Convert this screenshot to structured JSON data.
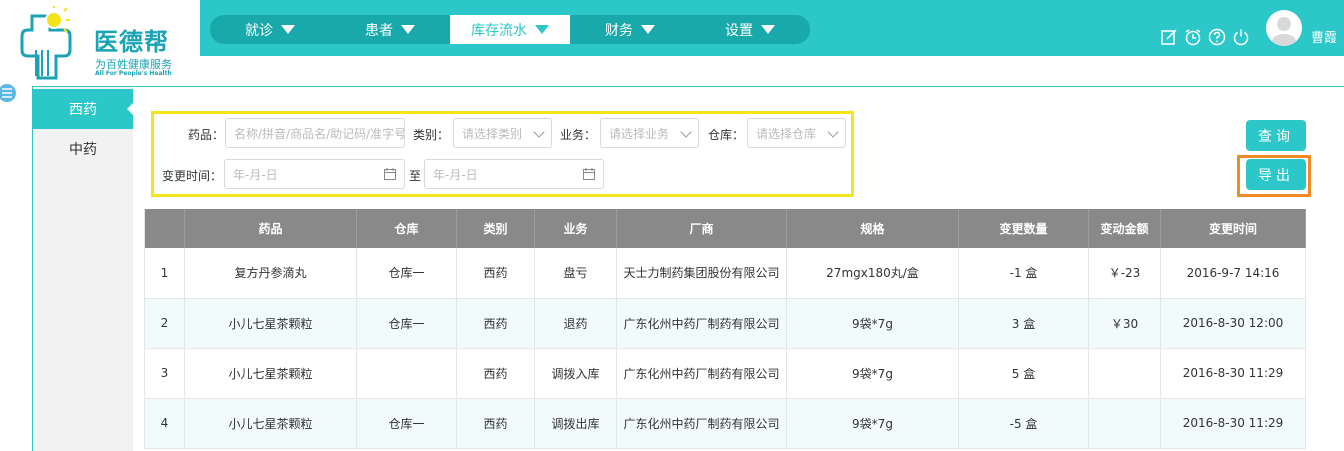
{
  "brand": {
    "name": "医德帮",
    "slogan": "为百姓健康服务",
    "slogan_en": "All For People's Health"
  },
  "nav": {
    "items": [
      {
        "label": "就诊",
        "active": false
      },
      {
        "label": "患者",
        "active": false
      },
      {
        "label": "库存流水",
        "active": true
      },
      {
        "label": "财务",
        "active": false
      },
      {
        "label": "设置",
        "active": false
      }
    ]
  },
  "header": {
    "icons": [
      "edit-icon",
      "clock-icon",
      "help-icon",
      "power-icon"
    ],
    "user_name": "曹霞"
  },
  "side_tabs": [
    {
      "label": "西药",
      "active": true
    },
    {
      "label": "中药",
      "active": false
    }
  ],
  "filter": {
    "drug_label": "药品：",
    "drug_placeholder": "名称/拼音/商品名/助记码/准字号",
    "category_label": "类别：",
    "category_placeholder": "请选择类别",
    "business_label": "业务：",
    "business_placeholder": "请选择业务",
    "warehouse_label": "仓库：",
    "warehouse_placeholder": "请选择仓库",
    "time_label": "变更时间：",
    "date_start_placeholder": "年-月-日",
    "to_label": "至",
    "date_end_placeholder": "年-月-日"
  },
  "buttons": {
    "query": "查询",
    "export": "导出"
  },
  "table": {
    "headers": [
      "",
      "药品",
      "仓库",
      "类别",
      "业务",
      "厂商",
      "规格",
      "变更数量",
      "变动金额",
      "变更时间"
    ],
    "rows": [
      [
        "1",
        "复方丹参滴丸",
        "仓库一",
        "西药",
        "盘亏",
        "天士力制药集团股份有限公司",
        "27mgx180丸/盒",
        "-1 盒",
        "￥-23",
        "2016-9-7 14:16"
      ],
      [
        "2",
        "小儿七星茶颗粒",
        "仓库一",
        "西药",
        "退药",
        "广东化州中药厂制药有限公司",
        "9袋*7g",
        "3 盒",
        "￥30",
        "2016-8-30 12:00"
      ],
      [
        "3",
        "小儿七星茶颗粒",
        "",
        "西药",
        "调拨入库",
        "广东化州中药厂制药有限公司",
        "9袋*7g",
        "5 盒",
        "",
        "2016-8-30 11:29"
      ],
      [
        "4",
        "小儿七星茶颗粒",
        "仓库一",
        "西药",
        "调拨出库",
        "广东化州中药厂制药有限公司",
        "9袋*7g",
        "-5 盒",
        "",
        "2016-8-30 11:29"
      ]
    ]
  },
  "colors": {
    "accent": "#2cc8c9",
    "nav_bg": "#1aa9ab",
    "table_header": "#898989",
    "filter_highlight": "#f5e41a",
    "export_highlight": "#f08a24"
  }
}
